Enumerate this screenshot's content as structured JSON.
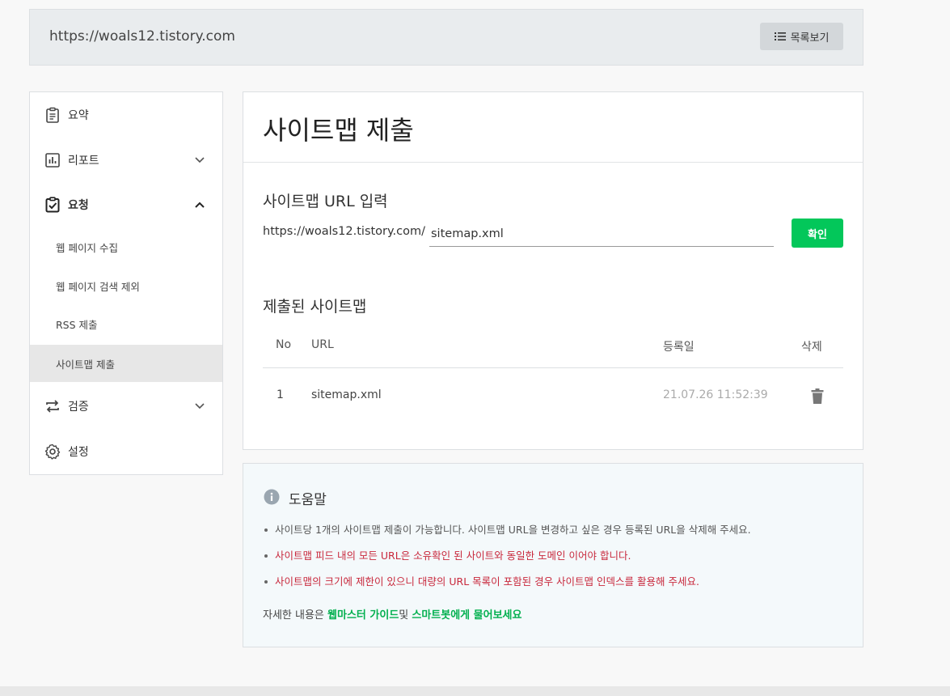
{
  "header": {
    "site_url": "https://woals12.tistory.com",
    "list_button_label": "목록보기",
    "list_icon": "list-icon"
  },
  "sidebar": {
    "items": [
      {
        "label": "요약",
        "icon": "clipboard-icon"
      },
      {
        "label": "리포트",
        "icon": "bar-chart-icon",
        "expanded": false
      },
      {
        "label": "요청",
        "icon": "clipboard-check-icon",
        "expanded": true
      },
      {
        "label": "검증",
        "icon": "repeat-arrows-icon",
        "expanded": false
      },
      {
        "label": "설정",
        "icon": "gear-icon"
      }
    ],
    "sub_items": [
      {
        "label": "웹 페이지 수집"
      },
      {
        "label": "웹 페이지 검색 제외"
      },
      {
        "label": "RSS 제출"
      },
      {
        "label": "사이트맵 제출",
        "active": true
      }
    ]
  },
  "main": {
    "title": "사이트맵 제출",
    "input_section": {
      "heading": "사이트맵 URL 입력",
      "prefix": "https://woals12.tistory.com/",
      "value": "sitemap.xml",
      "confirm_label": "확인"
    },
    "submitted_section": {
      "heading": "제출된 사이트맵",
      "columns": [
        "No",
        "URL",
        "등록일",
        "삭제"
      ],
      "rows": [
        {
          "no": "1",
          "url": "sitemap.xml",
          "date": "21.07.26 11:52:39",
          "delete_icon": "trash-icon"
        }
      ]
    }
  },
  "help": {
    "title": "도움말",
    "icon": "info-icon",
    "items": [
      {
        "text": "사이트당 1개의 사이트맵 제출이 가능합니다. 사이트맵 URL을 변경하고 싶은 경우 등록된 URL을 삭제해 주세요.",
        "color": "#555555"
      },
      {
        "text": "사이트맵 피드 내의 모든 URL은 소유확인 된 사이트와 동일한 도메인 이어야 합니다.",
        "color": "#c8283c"
      },
      {
        "text": "사이트맵의 크기에 제한이 있으니 대량의 URL 목록이 포함된 경우 사이트맵 인덱스를 활용해 주세요.",
        "color": "#c8283c"
      }
    ],
    "footer_prefix": "자세한 내용은 ",
    "footer_link1": "웹마스터 가이드",
    "footer_mid": "및 ",
    "footer_link2": "스마트봇에게 물어보세요",
    "link_color": "#03b04f"
  },
  "colors": {
    "accent_green": "#03c75a",
    "active_bg": "#e7e7e7",
    "warning_red": "#c8283c"
  }
}
